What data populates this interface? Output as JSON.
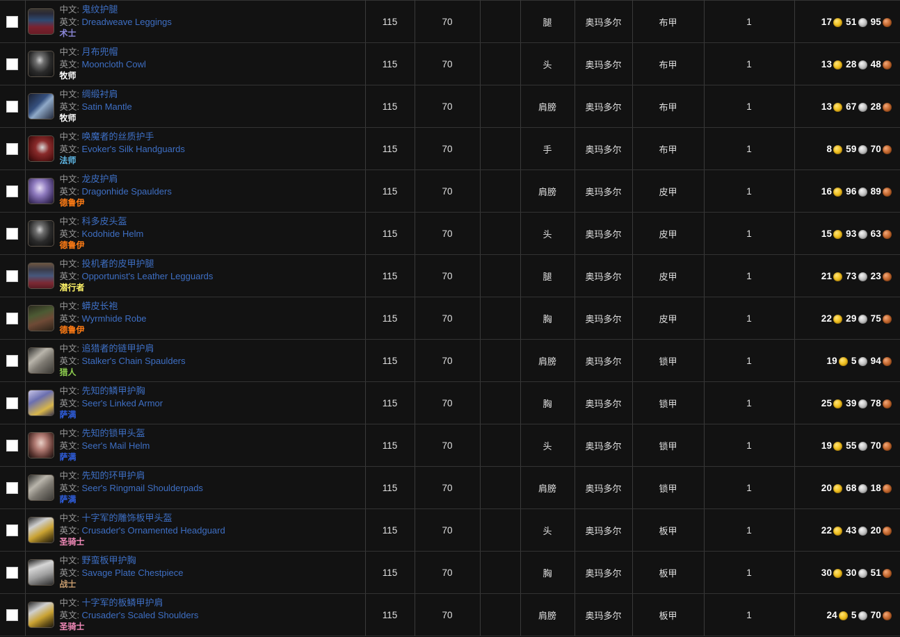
{
  "labels": {
    "cn": "中文:",
    "en": "英文:"
  },
  "colors": {
    "item_name": "#3e6fc4",
    "label": "#9a9a9a",
    "gold": "#f2c425",
    "silver": "#c9c9c9",
    "copper": "#c96d35",
    "row_bg": "#121212",
    "border": "#3a3a3a"
  },
  "class_colors": {
    "术士": "#8a86d6",
    "牧师": "#ffffff",
    "法师": "#5fb8e6",
    "德鲁伊": "#ff7c15",
    "潜行者": "#fff468",
    "猎人": "#8ece4f",
    "萨满": "#2f5fe0",
    "圣骑士": "#f38bba",
    "战士": "#c69b6d"
  },
  "rows": [
    {
      "name_cn": "鬼纹护腿",
      "name_en": "Dreadweave Leggings",
      "cls": "术士",
      "cls_key": "warlock",
      "ilvl": "115",
      "level": "70",
      "blank": "",
      "slot": "腿",
      "zone": "奥玛多尔",
      "armor": "布甲",
      "count": "1",
      "gold": "17",
      "silver": "51",
      "copper": "95",
      "icon": "legs-cloth-blue"
    },
    {
      "name_cn": "月布兜帽",
      "name_en": "Mooncloth Cowl",
      "cls": "牧师",
      "cls_key": "priest",
      "ilvl": "115",
      "level": "70",
      "blank": "",
      "slot": "头",
      "zone": "奥玛多尔",
      "armor": "布甲",
      "count": "1",
      "gold": "13",
      "silver": "28",
      "copper": "48",
      "icon": "hood-dark"
    },
    {
      "name_cn": "绸缎衬肩",
      "name_en": "Satin Mantle",
      "cls": "牧师",
      "cls_key": "priest",
      "ilvl": "115",
      "level": "70",
      "blank": "",
      "slot": "肩膀",
      "zone": "奥玛多尔",
      "armor": "布甲",
      "count": "1",
      "gold": "13",
      "silver": "67",
      "copper": "28",
      "icon": "mantle-blue"
    },
    {
      "name_cn": "唤魔者的丝质护手",
      "name_en": "Evoker's Silk Handguards",
      "cls": "法师",
      "cls_key": "mage",
      "ilvl": "115",
      "level": "70",
      "blank": "",
      "slot": "手",
      "zone": "奥玛多尔",
      "armor": "布甲",
      "count": "1",
      "gold": "8",
      "silver": "59",
      "copper": "70",
      "icon": "gloves-red"
    },
    {
      "name_cn": "龙皮护肩",
      "name_en": "Dragonhide Spaulders",
      "cls": "德鲁伊",
      "cls_key": "druid",
      "ilvl": "115",
      "level": "70",
      "blank": "",
      "slot": "肩膀",
      "zone": "奥玛多尔",
      "armor": "皮甲",
      "count": "1",
      "gold": "16",
      "silver": "96",
      "copper": "89",
      "icon": "spaulders-purple"
    },
    {
      "name_cn": "科多皮头盔",
      "name_en": "Kodohide Helm",
      "cls": "德鲁伊",
      "cls_key": "druid",
      "ilvl": "115",
      "level": "70",
      "blank": "",
      "slot": "头",
      "zone": "奥玛多尔",
      "armor": "皮甲",
      "count": "1",
      "gold": "15",
      "silver": "93",
      "copper": "63",
      "icon": "hood-dark"
    },
    {
      "name_cn": "投机者的皮甲护腿",
      "name_en": "Opportunist's Leather Legguards",
      "cls": "潜行者",
      "cls_key": "rogue",
      "ilvl": "115",
      "level": "70",
      "blank": "",
      "slot": "腿",
      "zone": "奥玛多尔",
      "armor": "皮甲",
      "count": "1",
      "gold": "21",
      "silver": "73",
      "copper": "23",
      "icon": "legs-leather"
    },
    {
      "name_cn": "蟒皮长袍",
      "name_en": "Wyrmhide Robe",
      "cls": "德鲁伊",
      "cls_key": "druid",
      "ilvl": "115",
      "level": "70",
      "blank": "",
      "slot": "胸",
      "zone": "奥玛多尔",
      "armor": "皮甲",
      "count": "1",
      "gold": "22",
      "silver": "29",
      "copper": "75",
      "icon": "robe-green"
    },
    {
      "name_cn": "追猎者的链甲护肩",
      "name_en": "Stalker's Chain Spaulders",
      "cls": "猎人",
      "cls_key": "hunter",
      "ilvl": "115",
      "level": "70",
      "blank": "",
      "slot": "肩膀",
      "zone": "奥玛多尔",
      "armor": "锁甲",
      "count": "1",
      "gold": "19",
      "silver": "5",
      "copper": "94",
      "icon": "spaulders-mail"
    },
    {
      "name_cn": "先知的鳞甲护胸",
      "name_en": "Seer's Linked Armor",
      "cls": "萨满",
      "cls_key": "shaman",
      "ilvl": "115",
      "level": "70",
      "blank": "",
      "slot": "胸",
      "zone": "奥玛多尔",
      "armor": "锁甲",
      "count": "1",
      "gold": "25",
      "silver": "39",
      "copper": "78",
      "icon": "chest-mail-blue"
    },
    {
      "name_cn": "先知的锁甲头盔",
      "name_en": "Seer's Mail Helm",
      "cls": "萨满",
      "cls_key": "shaman",
      "ilvl": "115",
      "level": "70",
      "blank": "",
      "slot": "头",
      "zone": "奥玛多尔",
      "armor": "锁甲",
      "count": "1",
      "gold": "19",
      "silver": "55",
      "copper": "70",
      "icon": "helm-mail-pink"
    },
    {
      "name_cn": "先知的环甲护肩",
      "name_en": "Seer's Ringmail Shoulderpads",
      "cls": "萨满",
      "cls_key": "shaman",
      "ilvl": "115",
      "level": "70",
      "blank": "",
      "slot": "肩膀",
      "zone": "奥玛多尔",
      "armor": "锁甲",
      "count": "1",
      "gold": "20",
      "silver": "68",
      "copper": "18",
      "icon": "spaulders-mail"
    },
    {
      "name_cn": "十字军的雕饰板甲头盔",
      "name_en": "Crusader's Ornamented Headguard",
      "cls": "圣骑士",
      "cls_key": "paladin",
      "ilvl": "115",
      "level": "70",
      "blank": "",
      "slot": "头",
      "zone": "奥玛多尔",
      "armor": "板甲",
      "count": "1",
      "gold": "22",
      "silver": "43",
      "copper": "20",
      "icon": "helm-plate-gold"
    },
    {
      "name_cn": "野蛮板甲护胸",
      "name_en": "Savage Plate Chestpiece",
      "cls": "战士",
      "cls_key": "warrior",
      "ilvl": "115",
      "level": "70",
      "blank": "",
      "slot": "胸",
      "zone": "奥玛多尔",
      "armor": "板甲",
      "count": "1",
      "gold": "30",
      "silver": "30",
      "copper": "51",
      "icon": "chest-plate"
    },
    {
      "name_cn": "十字军的板鳞甲护肩",
      "name_en": "Crusader's Scaled Shoulders",
      "cls": "圣骑士",
      "cls_key": "paladin",
      "ilvl": "115",
      "level": "70",
      "blank": "",
      "slot": "肩膀",
      "zone": "奥玛多尔",
      "armor": "板甲",
      "count": "1",
      "gold": "24",
      "silver": "5",
      "copper": "70",
      "icon": "helm-plate-gold"
    }
  ]
}
